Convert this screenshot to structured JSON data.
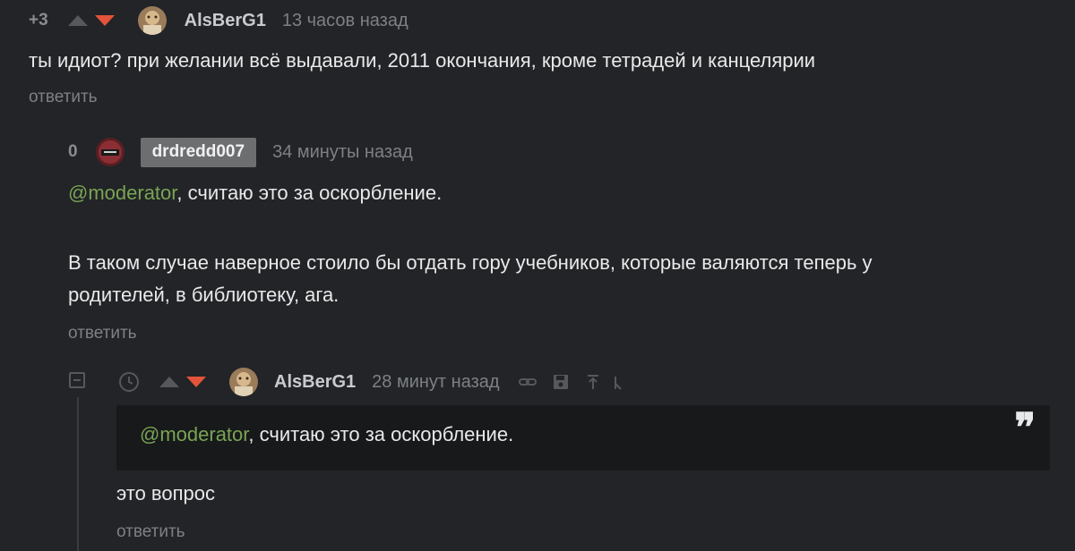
{
  "comments": [
    {
      "rating": "+3",
      "username": "AlsBerG1",
      "time": "13 часов назад",
      "text": "ты идиот? при желании всё выдавали, 2011 окончания, кроме тетрадей и канцелярии",
      "reply_label": "ответить"
    },
    {
      "rating": "0",
      "username": "drdredd007",
      "time": "34 минуты назад",
      "mention": "@moderator",
      "text_after_mention": ", считаю это за оскорбление.",
      "paragraph_2_line_1": "В таком случае наверное стоило бы отдать гору учебников, которые валяются теперь у",
      "paragraph_2_line_2": "родителей, в библиотеку, ага.",
      "reply_label": "ответить"
    },
    {
      "username": "AlsBerG1",
      "time": "28 минут назад",
      "quote_mention": "@moderator",
      "quote_text": ", считаю это за оскорбление.",
      "text": "это вопрос",
      "reply_label": "ответить"
    }
  ],
  "colors": {
    "background": "#222427",
    "downvote_active": "#e4533b",
    "mention": "#7aa454",
    "muted": "#7d8085"
  }
}
